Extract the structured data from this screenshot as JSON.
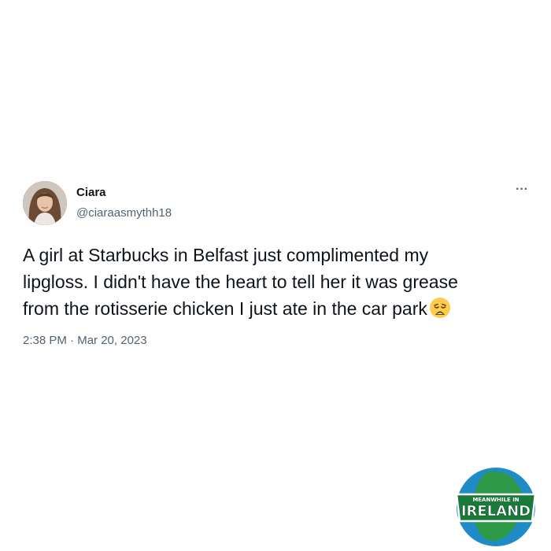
{
  "tweet": {
    "author_name": "Ciara",
    "author_handle": "@ciaraasmythh18",
    "more_icon": "more-horizontal-icon",
    "text": "A girl at Starbucks in Belfast just complimented my\nlipgloss. I didn't have the heart to tell her it was grease\nfrom the rotisserie chicken I just ate in the car park",
    "emoji": "weary-face-emoji",
    "time": "2:38 PM",
    "separator": "·",
    "date": "Mar 20, 2023"
  },
  "watermark": {
    "top_text": "MEANWHILE IN",
    "main_text": "IRELAND"
  },
  "colors": {
    "text": "#0f1419",
    "muted": "#536471",
    "logo_ocean": "#1f8cc8",
    "logo_land": "#2e9a48",
    "logo_banner": "#1a7a3a"
  }
}
